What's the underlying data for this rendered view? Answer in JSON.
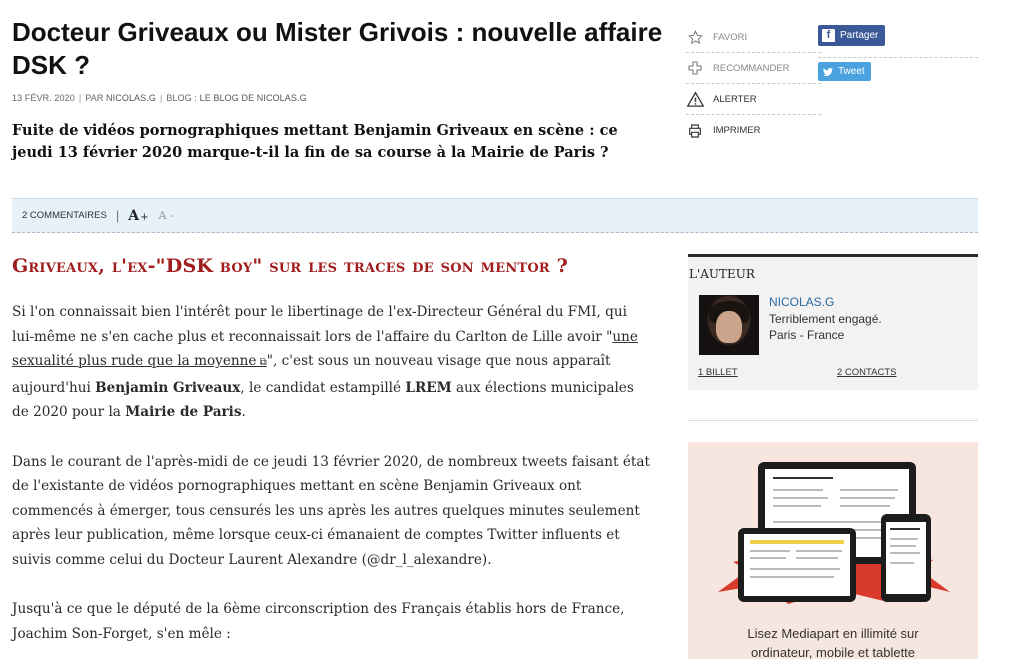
{
  "article": {
    "title": "Docteur Griveaux ou Mister Grivois : nouvelle affaire DSK ?",
    "date": "13 FÉVR. 2020",
    "by_prefix": "PAR",
    "author": "NICOLAS.G",
    "blog_prefix": "BLOG :",
    "blog_name": "LE BLOG DE NICOLAS.G",
    "lede": "Fuite de vidéos pornographiques mettant Benjamin Griveaux en scène : ce jeudi 13 février 2020 marque-t-il la fin de sa course à la Mairie de Paris ?",
    "subheading": "Griveaux, l'ex-\"DSK boy\" sur les traces de son mentor ?",
    "p1": {
      "a": "Si l'on connaissait bien l'intérêt pour le libertinage de l'ex-Directeur Général du FMI, qui lui-même ne s'en cache plus et reconnaissait lors de l'affaire du Carlton de Lille avoir \"",
      "link": "une sexualité plus rude que la moyenne",
      "b": "\", c'est sous un nouveau visage que nous apparaît aujourd'hui ",
      "bold1": "Benjamin Griveaux",
      "c": ", le candidat estampillé ",
      "bold2": "LREM",
      "d": " aux élections municipales de 2020 pour la ",
      "bold3": "Mairie de Paris",
      "e": "."
    },
    "p2": "Dans le courant de l'après-midi de ce jeudi 13 février 2020, de nombreux tweets faisant état de l'existante de vidéos pornographiques mettant en scène Benjamin Griveaux ont commencés à émerger, tous censurés les uns après les autres quelques minutes seulement après leur publication, même lorsque ceux-ci émanaient de comptes Twitter influents et suivis comme celui du Docteur Laurent Alexandre (@dr_l_alexandre).",
    "p3": "Jusqu'à ce que le député de la 6ème circonscription des Français établis hors de France, Joachim Son-Forget, s'en mêle :"
  },
  "actions": {
    "favori": "FAVORI",
    "recommander": "RECOMMANDER",
    "alerter": "ALERTER",
    "imprimer": "IMPRIMER"
  },
  "social": {
    "facebook": "Partager",
    "twitter": "Tweet"
  },
  "comments_bar": {
    "comments": "2 COMMENTAIRES",
    "font_increase": "A",
    "font_increase_sign": "+",
    "font_decrease": "A -"
  },
  "author_box": {
    "heading": "L'AUTEUR",
    "name": "NICOLAS.G",
    "tagline": "Terriblement engagé.",
    "location": "Paris - France",
    "billets": "1 BILLET",
    "contacts": "2 CONTACTS"
  },
  "promo": {
    "line1": "Lisez Mediapart en illimité sur",
    "line2": "ordinateur, mobile et tablette"
  },
  "colors": {
    "accent_red": "#a11d1d",
    "facebook": "#3b5998",
    "twitter": "#4aa3df",
    "bar_bg": "#e7f1fa",
    "promo_bg": "#f7e6df"
  }
}
